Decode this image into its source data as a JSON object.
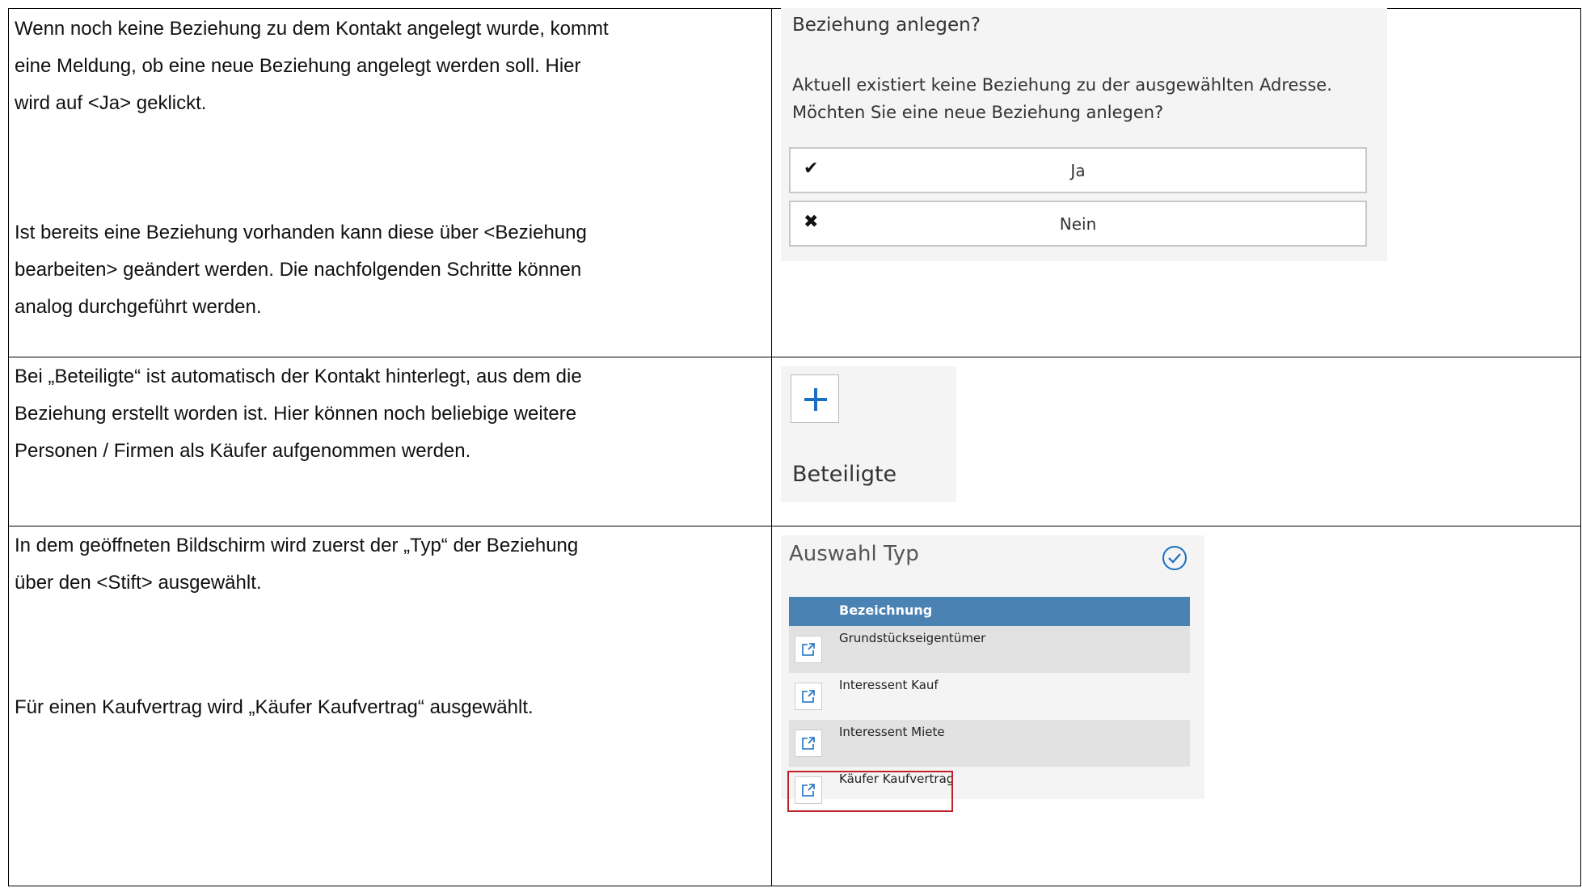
{
  "row1": {
    "text_a": [
      "Wenn noch keine Beziehung zu dem Kontakt angelegt wurde, kommt",
      "eine Meldung, ob eine neue Beziehung angelegt werden soll. Hier",
      "wird auf <Ja> geklickt."
    ],
    "text_b": [
      "Ist bereits eine Beziehung vorhanden kann diese über <Beziehung",
      "bearbeiten> geändert werden. Die nachfolgenden Schritte können",
      "analog durchgeführt werden."
    ],
    "dialog": {
      "title": "Beziehung anlegen?",
      "message_line1": "Aktuell existiert keine Beziehung zu der ausgewählten Adresse.",
      "message_line2": "Möchten Sie eine neue Beziehung anlegen?",
      "yes_icon": "check-icon",
      "yes_label": "Ja",
      "no_icon": "x-icon",
      "no_label": "Nein"
    }
  },
  "row2": {
    "text": [
      "Bei „Beteiligte“ ist automatisch der Kontakt hinterlegt, aus dem die",
      "Beziehung erstellt worden ist. Hier können noch beliebige weitere",
      "Personen / Firmen als Käufer aufgenommen werden."
    ],
    "widget": {
      "plus_icon": "plus-icon",
      "label": "Beteiligte"
    }
  },
  "row3": {
    "text_a": [
      "In dem geöffneten Bildschirm wird zuerst der „Typ“ der Beziehung",
      "über den <Stift> ausgewählt."
    ],
    "text_b": [
      "Für einen Kaufvertrag wird „Käufer Kaufvertrag“ ausgewählt."
    ],
    "auswahl": {
      "title": "Auswahl Typ",
      "confirm_icon": "circle-check-icon",
      "column_header": "Bezeichnung",
      "rows": [
        "Grundstückseigentümer",
        "Interessent Kauf",
        "Interessent Miete",
        "Käufer Kaufvertrag"
      ],
      "highlight_color": "#c0202a"
    }
  },
  "colors": {
    "header_blue": "#4a82b4",
    "panel_bg": "#f4f4f4",
    "accent_blue": "#1a6fc0"
  }
}
